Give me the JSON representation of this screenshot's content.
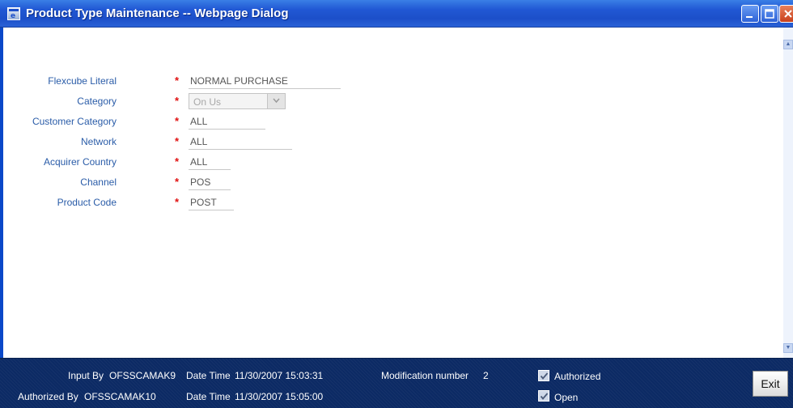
{
  "window": {
    "title": "Product Type Maintenance -- Webpage Dialog"
  },
  "form": {
    "required_mark": "*",
    "fields": [
      {
        "label": "Flexcube Literal",
        "value": "NORMAL PURCHASE"
      },
      {
        "label": "Category",
        "value": "On Us"
      },
      {
        "label": "Customer Category",
        "value": "ALL"
      },
      {
        "label": "Network",
        "value": "ALL"
      },
      {
        "label": "Acquirer Country",
        "value": "ALL"
      },
      {
        "label": "Channel",
        "value": "POS"
      },
      {
        "label": "Product Code",
        "value": "POST"
      }
    ]
  },
  "footer": {
    "input_by_label": "Input By",
    "input_by": "OFSSCAMAK9",
    "authorized_by_label": "Authorized By",
    "authorized_by": "OFSSCAMAK10",
    "datetime_label": "Date Time",
    "input_datetime": "11/30/2007 15:03:31",
    "authorized_datetime": "11/30/2007 15:05:00",
    "modification_label": "Modification number",
    "modification_number": "2",
    "authorized_checkbox_label": "Authorized",
    "open_checkbox_label": "Open",
    "exit_label": "Exit"
  },
  "colors": {
    "titlebar": "#2158d4",
    "label": "#2a5ca8",
    "required": "#e01010",
    "footer": "#0c2a64"
  },
  "icons": {
    "window": "ie-window-icon",
    "minimize": "minimize-icon",
    "maximize": "maximize-icon",
    "close": "close-icon",
    "dropdown": "chevron-down-icon",
    "check": "checkmark-icon"
  }
}
